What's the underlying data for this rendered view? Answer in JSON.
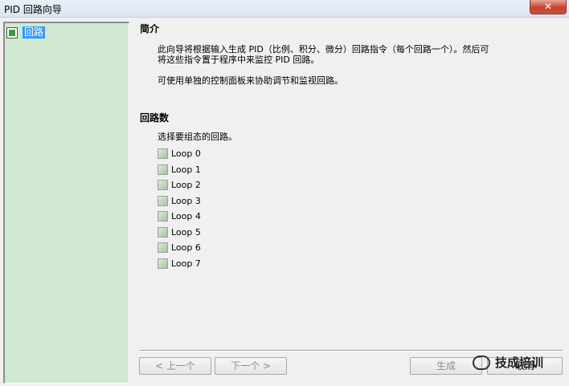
{
  "window": {
    "title": "PID 回路向导",
    "close_label": "✕"
  },
  "sidebar": {
    "items": [
      {
        "label": "回路"
      }
    ]
  },
  "intro": {
    "heading": "简介",
    "line1": "此向导将根据输入生成 PID（比例、积分、微分）回路指令（每个回路一个）。然后可",
    "line2": "将这些指令置于程序中来监控 PID 回路。",
    "line3": "可使用单独的控制面板来协助调节和监视回路。"
  },
  "loops": {
    "heading": "回路数",
    "prompt": "选择要组态的回路。",
    "items": [
      {
        "label": "Loop 0",
        "checked": false
      },
      {
        "label": "Loop 1",
        "checked": false
      },
      {
        "label": "Loop 2",
        "checked": false
      },
      {
        "label": "Loop 3",
        "checked": false
      },
      {
        "label": "Loop 4",
        "checked": false
      },
      {
        "label": "Loop 5",
        "checked": false
      },
      {
        "label": "Loop 6",
        "checked": false
      },
      {
        "label": "Loop 7",
        "checked": false
      }
    ]
  },
  "buttons": {
    "prev": "< 上一个",
    "next": "下一个 >",
    "generate": "生成",
    "cancel": "取消"
  },
  "watermark": {
    "text": "技成培训"
  }
}
